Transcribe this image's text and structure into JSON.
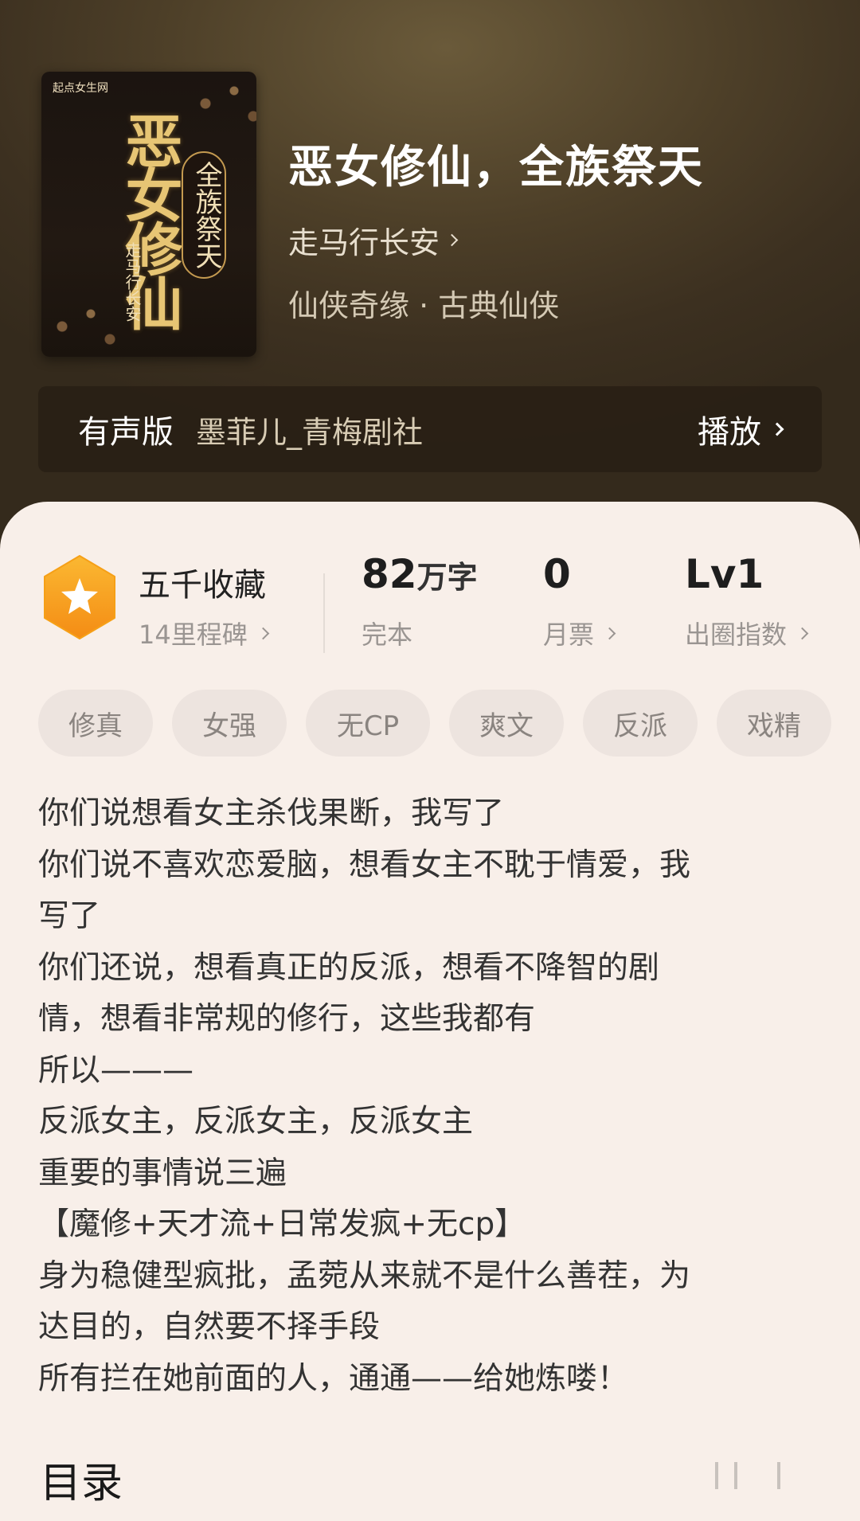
{
  "book": {
    "title": "恶女修仙，全族祭天",
    "author": "走马行长安",
    "genre": "仙侠奇缘 · 古典仙侠"
  },
  "cover": {
    "publisher": "起点女生网",
    "title": "恶女修仙",
    "subtitle": "全族祭天",
    "author": "走马行长安"
  },
  "audio": {
    "label": "有声版",
    "narrator": "墨菲儿_青梅剧社",
    "play_label": "播放"
  },
  "stats": {
    "collection": "五千收藏",
    "milestone": "14里程碑",
    "words_number": "82",
    "words_unit": "万字",
    "status": "完本",
    "monthly_votes": "0",
    "monthly_votes_label": "月票",
    "level": "Lv1",
    "level_label": "出圈指数"
  },
  "tags": [
    "修真",
    "女强",
    "无CP",
    "爽文",
    "反派",
    "戏精"
  ],
  "description": [
    "你们说想看女主杀伐果断，我写了",
    "你们说不喜欢恋爱脑，想看女主不耽于情爱，我",
    "写了",
    "你们还说，想看真正的反派，想看不降智的剧",
    "情，想看非常规的修行，这些我都有",
    "所以———",
    "反派女主，反派女主，反派女主",
    "重要的事情说三遍",
    "【魔修+天才流+日常发疯+无cp】",
    "身为稳健型疯批，孟菀从来就不是什么善茬，为",
    "达目的，自然要不择手段",
    "所有拦在她前面的人，通通——给她炼喽！"
  ],
  "toc": {
    "title": "目录"
  },
  "colors": {
    "badge": "#f7a51b",
    "hero": "#4d3f28",
    "sheet": "#f8efe9"
  }
}
